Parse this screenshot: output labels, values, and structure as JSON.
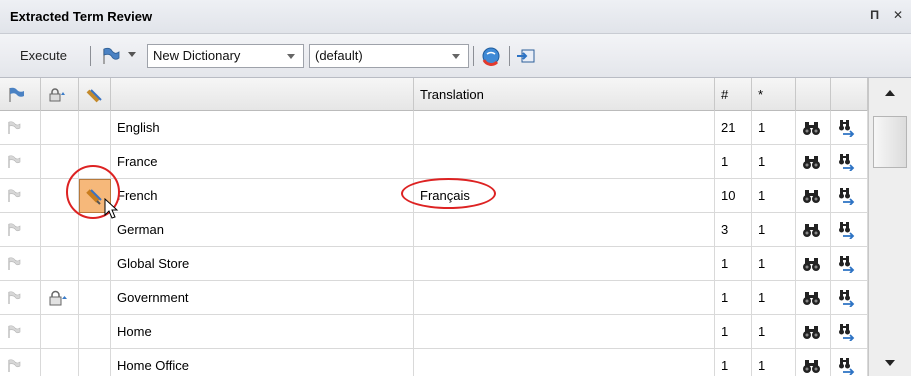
{
  "panel": {
    "title": "Extracted Term Review"
  },
  "toolbar": {
    "execute_label": "Execute",
    "dictionary_value": "New Dictionary",
    "profile_value": "(default)"
  },
  "columns": {
    "translation": "Translation",
    "count": "#",
    "star": "*"
  },
  "rows": [
    {
      "term": "English",
      "translation": "",
      "count": "21",
      "star": "1",
      "locked": false,
      "selected": false
    },
    {
      "term": "France",
      "translation": "",
      "count": "1",
      "star": "1",
      "locked": false,
      "selected": false
    },
    {
      "term": "French",
      "translation": "Français",
      "count": "10",
      "star": "1",
      "locked": false,
      "selected": true
    },
    {
      "term": "German",
      "translation": "",
      "count": "3",
      "star": "1",
      "locked": false,
      "selected": false
    },
    {
      "term": "Global Store",
      "translation": "",
      "count": "1",
      "star": "1",
      "locked": false,
      "selected": false
    },
    {
      "term": "Government",
      "translation": "",
      "count": "1",
      "star": "1",
      "locked": true,
      "selected": false
    },
    {
      "term": "Home",
      "translation": "",
      "count": "1",
      "star": "1",
      "locked": false,
      "selected": false
    },
    {
      "term": "Home Office",
      "translation": "",
      "count": "1",
      "star": "1",
      "locked": false,
      "selected": false
    }
  ],
  "icons": {
    "flag": "flag-icon",
    "lock": "lock-icon",
    "approve": "approve-pencil-icon",
    "find": "binoculars-icon",
    "find_next": "find-next-icon",
    "refresh": "refresh-icon",
    "export": "export-icon"
  },
  "colors": {
    "highlight": "#d22222",
    "selected_cell": "#f6b87a"
  }
}
